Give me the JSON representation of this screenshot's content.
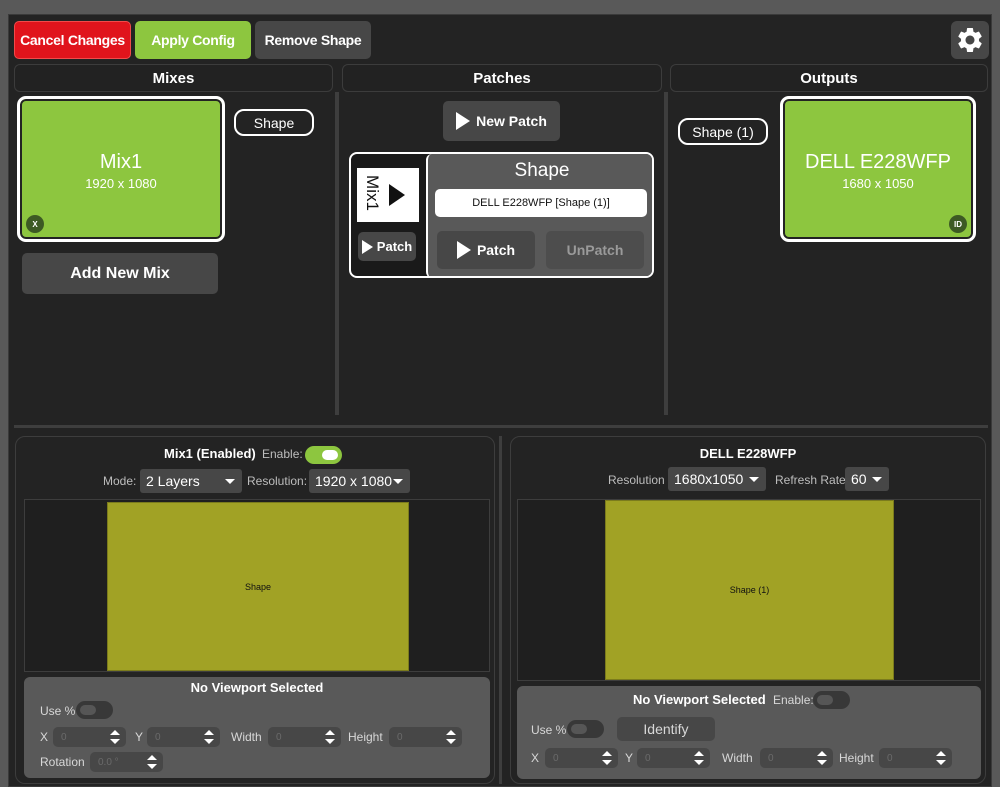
{
  "toolbar": {
    "cancel_label": "Cancel Changes",
    "apply_label": "Apply Config",
    "remove_label": "Remove Shape",
    "settings_icon": "gear-icon"
  },
  "colors": {
    "accent_green": "#8dc63f",
    "danger_red": "#e0141c",
    "shape_yellow": "#a1a225"
  },
  "mixes": {
    "header": "Mixes",
    "card_title": "Mix1",
    "card_resolution": "1920 x 1080",
    "card_badge": "X",
    "shape_pill": "Shape",
    "add_label": "Add New Mix"
  },
  "patches": {
    "header": "Patches",
    "new_patch_label": "New Patch",
    "mix_tile_label": "Mix1",
    "mix_patch_label": "Patch",
    "shape_title": "Shape",
    "shape_target": "DELL E228WFP [Shape (1)]",
    "patch_label": "Patch",
    "unpatch_label": "UnPatch"
  },
  "outputs": {
    "header": "Outputs",
    "shape_pill": "Shape (1)",
    "card_title": "DELL E228WFP",
    "card_resolution": "1680 x 1050",
    "card_badge": "ID"
  },
  "mix_panel": {
    "title": "Mix1 (Enabled)",
    "enable_label": "Enable:",
    "enabled": true,
    "mode_label": "Mode:",
    "mode_value": "2 Layers",
    "resolution_label": "Resolution:",
    "resolution_value": "1920 x 1080",
    "shape_label": "Shape",
    "viewport": {
      "title": "No Viewport Selected",
      "use_pct_label": "Use %",
      "x_label": "X",
      "x_value": "0",
      "y_label": "Y",
      "y_value": "0",
      "width_label": "Width",
      "width_value": "0",
      "height_label": "Height",
      "height_value": "0",
      "rotation_label": "Rotation",
      "rotation_value": "0.0 °"
    }
  },
  "output_panel": {
    "title": "DELL E228WFP",
    "resolution_label": "Resolution",
    "resolution_value": "1680x1050",
    "refresh_label": "Refresh Rate",
    "refresh_value": "60",
    "shape_label": "Shape (1)",
    "viewport": {
      "title": "No Viewport Selected",
      "enable_label": "Enable:",
      "use_pct_label": "Use %",
      "identify_label": "Identify",
      "x_label": "X",
      "x_value": "0",
      "y_label": "Y",
      "y_value": "0",
      "width_label": "Width",
      "width_value": "0",
      "height_label": "Height",
      "height_value": "0"
    }
  }
}
